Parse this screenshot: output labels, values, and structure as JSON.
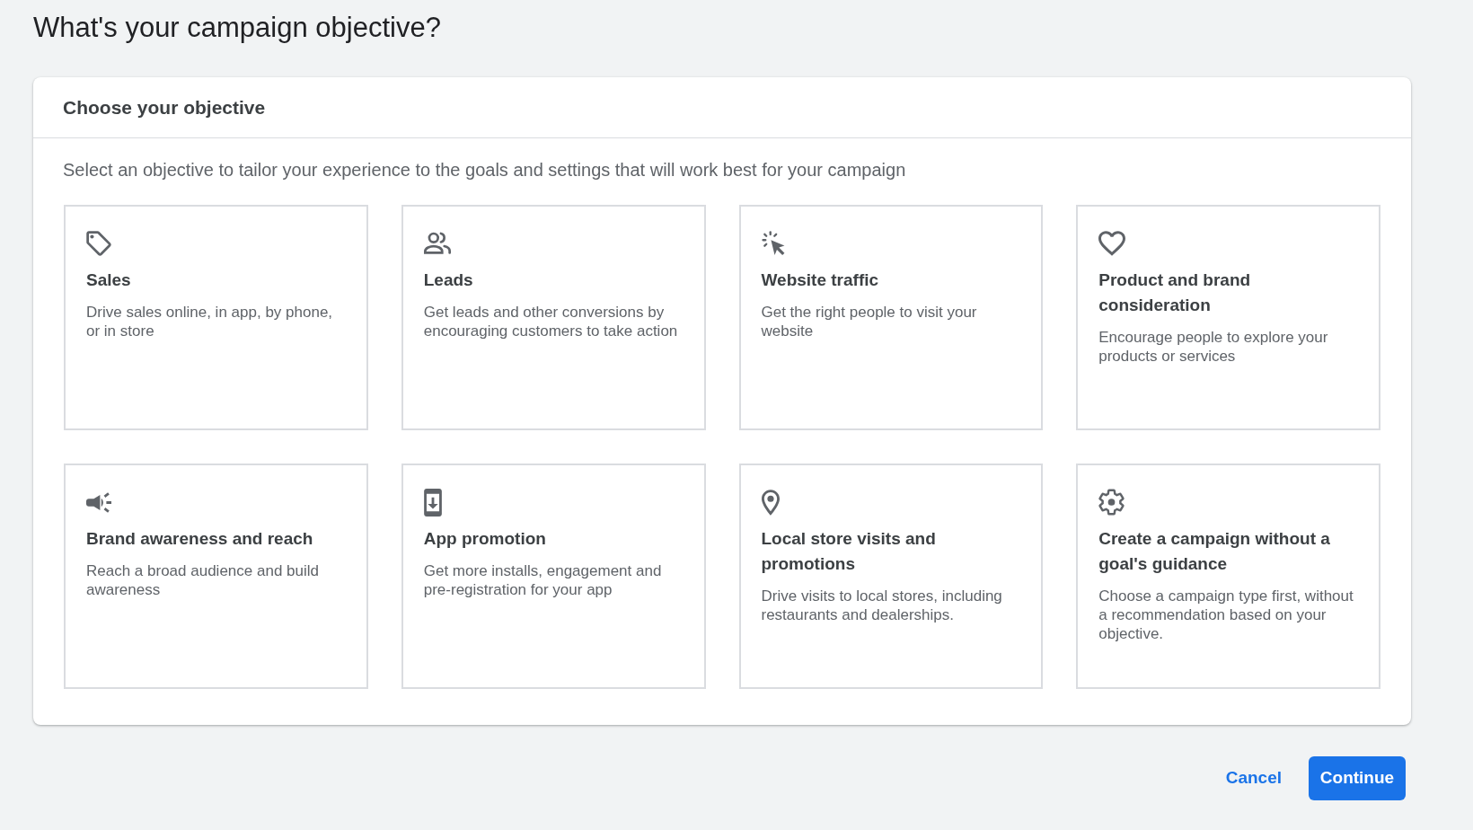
{
  "page_title": "What's your campaign objective?",
  "panel": {
    "title": "Choose your objective",
    "description": "Select an objective to tailor your experience to the goals and settings that will work best for your campaign",
    "objectives": [
      {
        "title": "Sales",
        "description": "Drive sales online, in app, by phone, or in store",
        "selected": false
      },
      {
        "title": "Leads",
        "description": "Get leads and other conversions by encouraging customers to take action",
        "selected": false
      },
      {
        "title": "Website traffic",
        "description": "Get the right people to visit your website",
        "selected": false
      },
      {
        "title": "Product and brand consideration",
        "description": "Encourage people to explore your products or services",
        "selected": false
      },
      {
        "title": "Brand awareness and reach",
        "description": "Reach a broad audience and build awareness",
        "selected": false
      },
      {
        "title": "App promotion",
        "description": "Get more installs, engagement and pre-registration for your app",
        "selected": false
      },
      {
        "title": "Local store visits and promotions",
        "description": "Drive visits to local stores, including restaurants and dealerships.",
        "selected": false
      },
      {
        "title": "Create a campaign without a goal's guidance",
        "description": "Choose a campaign type first, without a recommendation based on your objective.",
        "selected": false
      }
    ]
  },
  "actions": [
    {
      "label": "Cancel",
      "kind": "text"
    },
    {
      "label": "Continue",
      "kind": "filled"
    }
  ]
}
